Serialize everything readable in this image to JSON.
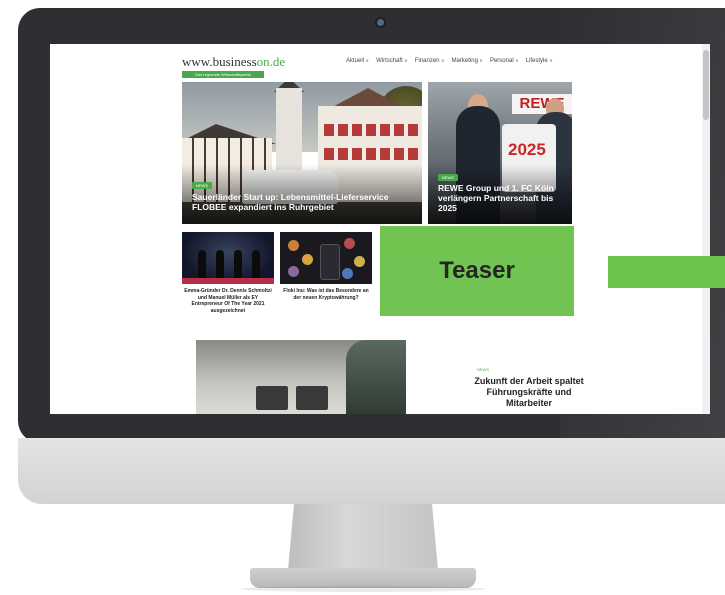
{
  "site": {
    "logo_text": "www.business",
    "logo_domain": "on.de",
    "logo_tagline": "Das regionale Wirtschaftsportal"
  },
  "nav": {
    "items": [
      "Aktuell",
      "Wirtschaft",
      "Finanzen",
      "Marketing",
      "Personal",
      "Lifestyle"
    ]
  },
  "featured": {
    "main": {
      "badge": "NEWS",
      "title": "Sauerländer Start up: Lebensmittel-Lieferservice FLOBEE expandiert ins Ruhrgebiet"
    },
    "side": {
      "badge": "NEWS",
      "title": "REWE Group und 1. FC Köln verlängern Partnerschaft bis 2025",
      "sign_text": "REWE",
      "jersey_number": "2025"
    }
  },
  "small_tiles": [
    {
      "caption": "Emma-Gründer Dr. Dennis Schmoltzi und Manuel Müller als EY Entrepreneur Of The Year 2021 ausgezeichnet"
    },
    {
      "caption": "Floki Inu: Was ist das Besondere an der neuen Kryptowährung?"
    }
  ],
  "teaser": {
    "label": "Teaser"
  },
  "article": {
    "badge": "NEWS",
    "title": "Zukunft der Arbeit spaltet Führungskräfte und Mitarbeiter"
  },
  "colors": {
    "brand_green": "#4aa84a",
    "teaser_green": "#6cc24a",
    "bezel": "#2f2f33"
  }
}
